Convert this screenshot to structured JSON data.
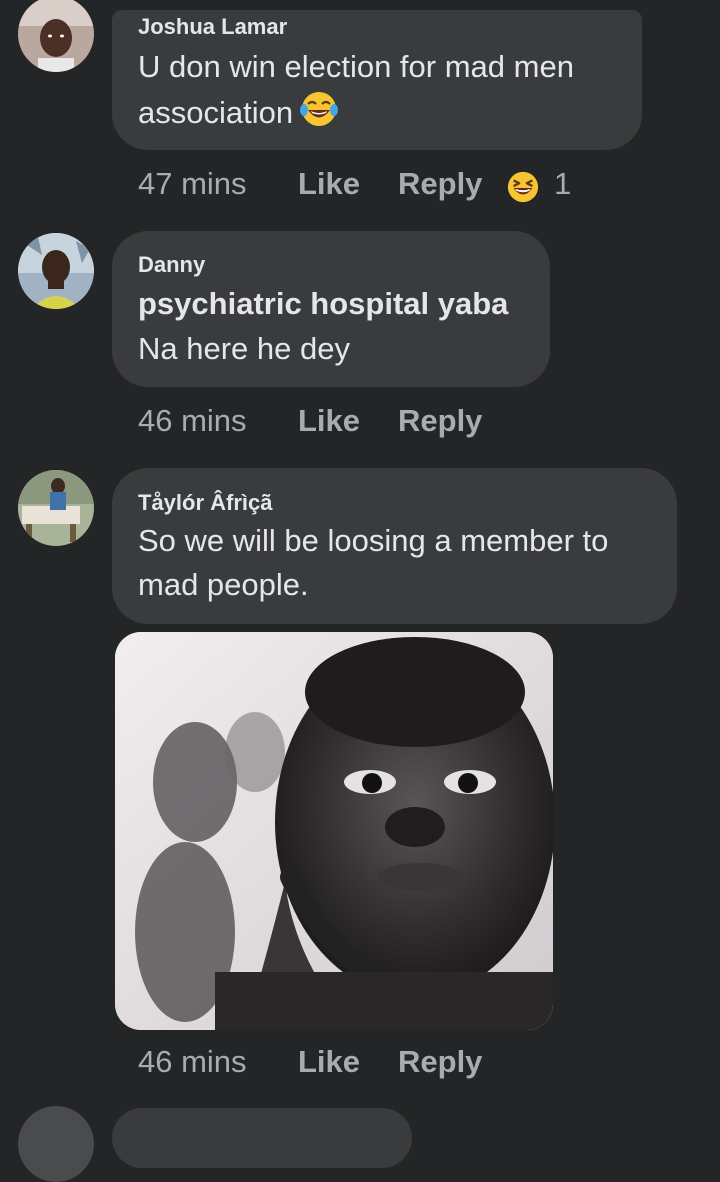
{
  "comments": [
    {
      "author": "Joshua Lamar",
      "lines": [
        "U don win election for mad men",
        "association"
      ],
      "inline_emoji": "tears-of-joy-emoji",
      "time": "47 mins",
      "like_label": "Like",
      "reply_label": "Reply",
      "reaction_emoji": "laughing-emoji",
      "reaction_count": "1"
    },
    {
      "author": "Danny",
      "lines": [
        "psychiatric hospital yaba",
        "Na here he dey"
      ],
      "time": "46 mins",
      "like_label": "Like",
      "reply_label": "Reply"
    },
    {
      "author": "Tåylór Âfrìçã",
      "lines": [
        "So we will be loosing a member to",
        "mad people."
      ],
      "attachment": "black-and-white-child-photo",
      "time": "46 mins",
      "like_label": "Like",
      "reply_label": "Reply"
    }
  ],
  "colors": {
    "background": "#242526",
    "bubble": "#3a3b3c",
    "text": "#e4e6eb",
    "secondary": "#a8abaf"
  }
}
